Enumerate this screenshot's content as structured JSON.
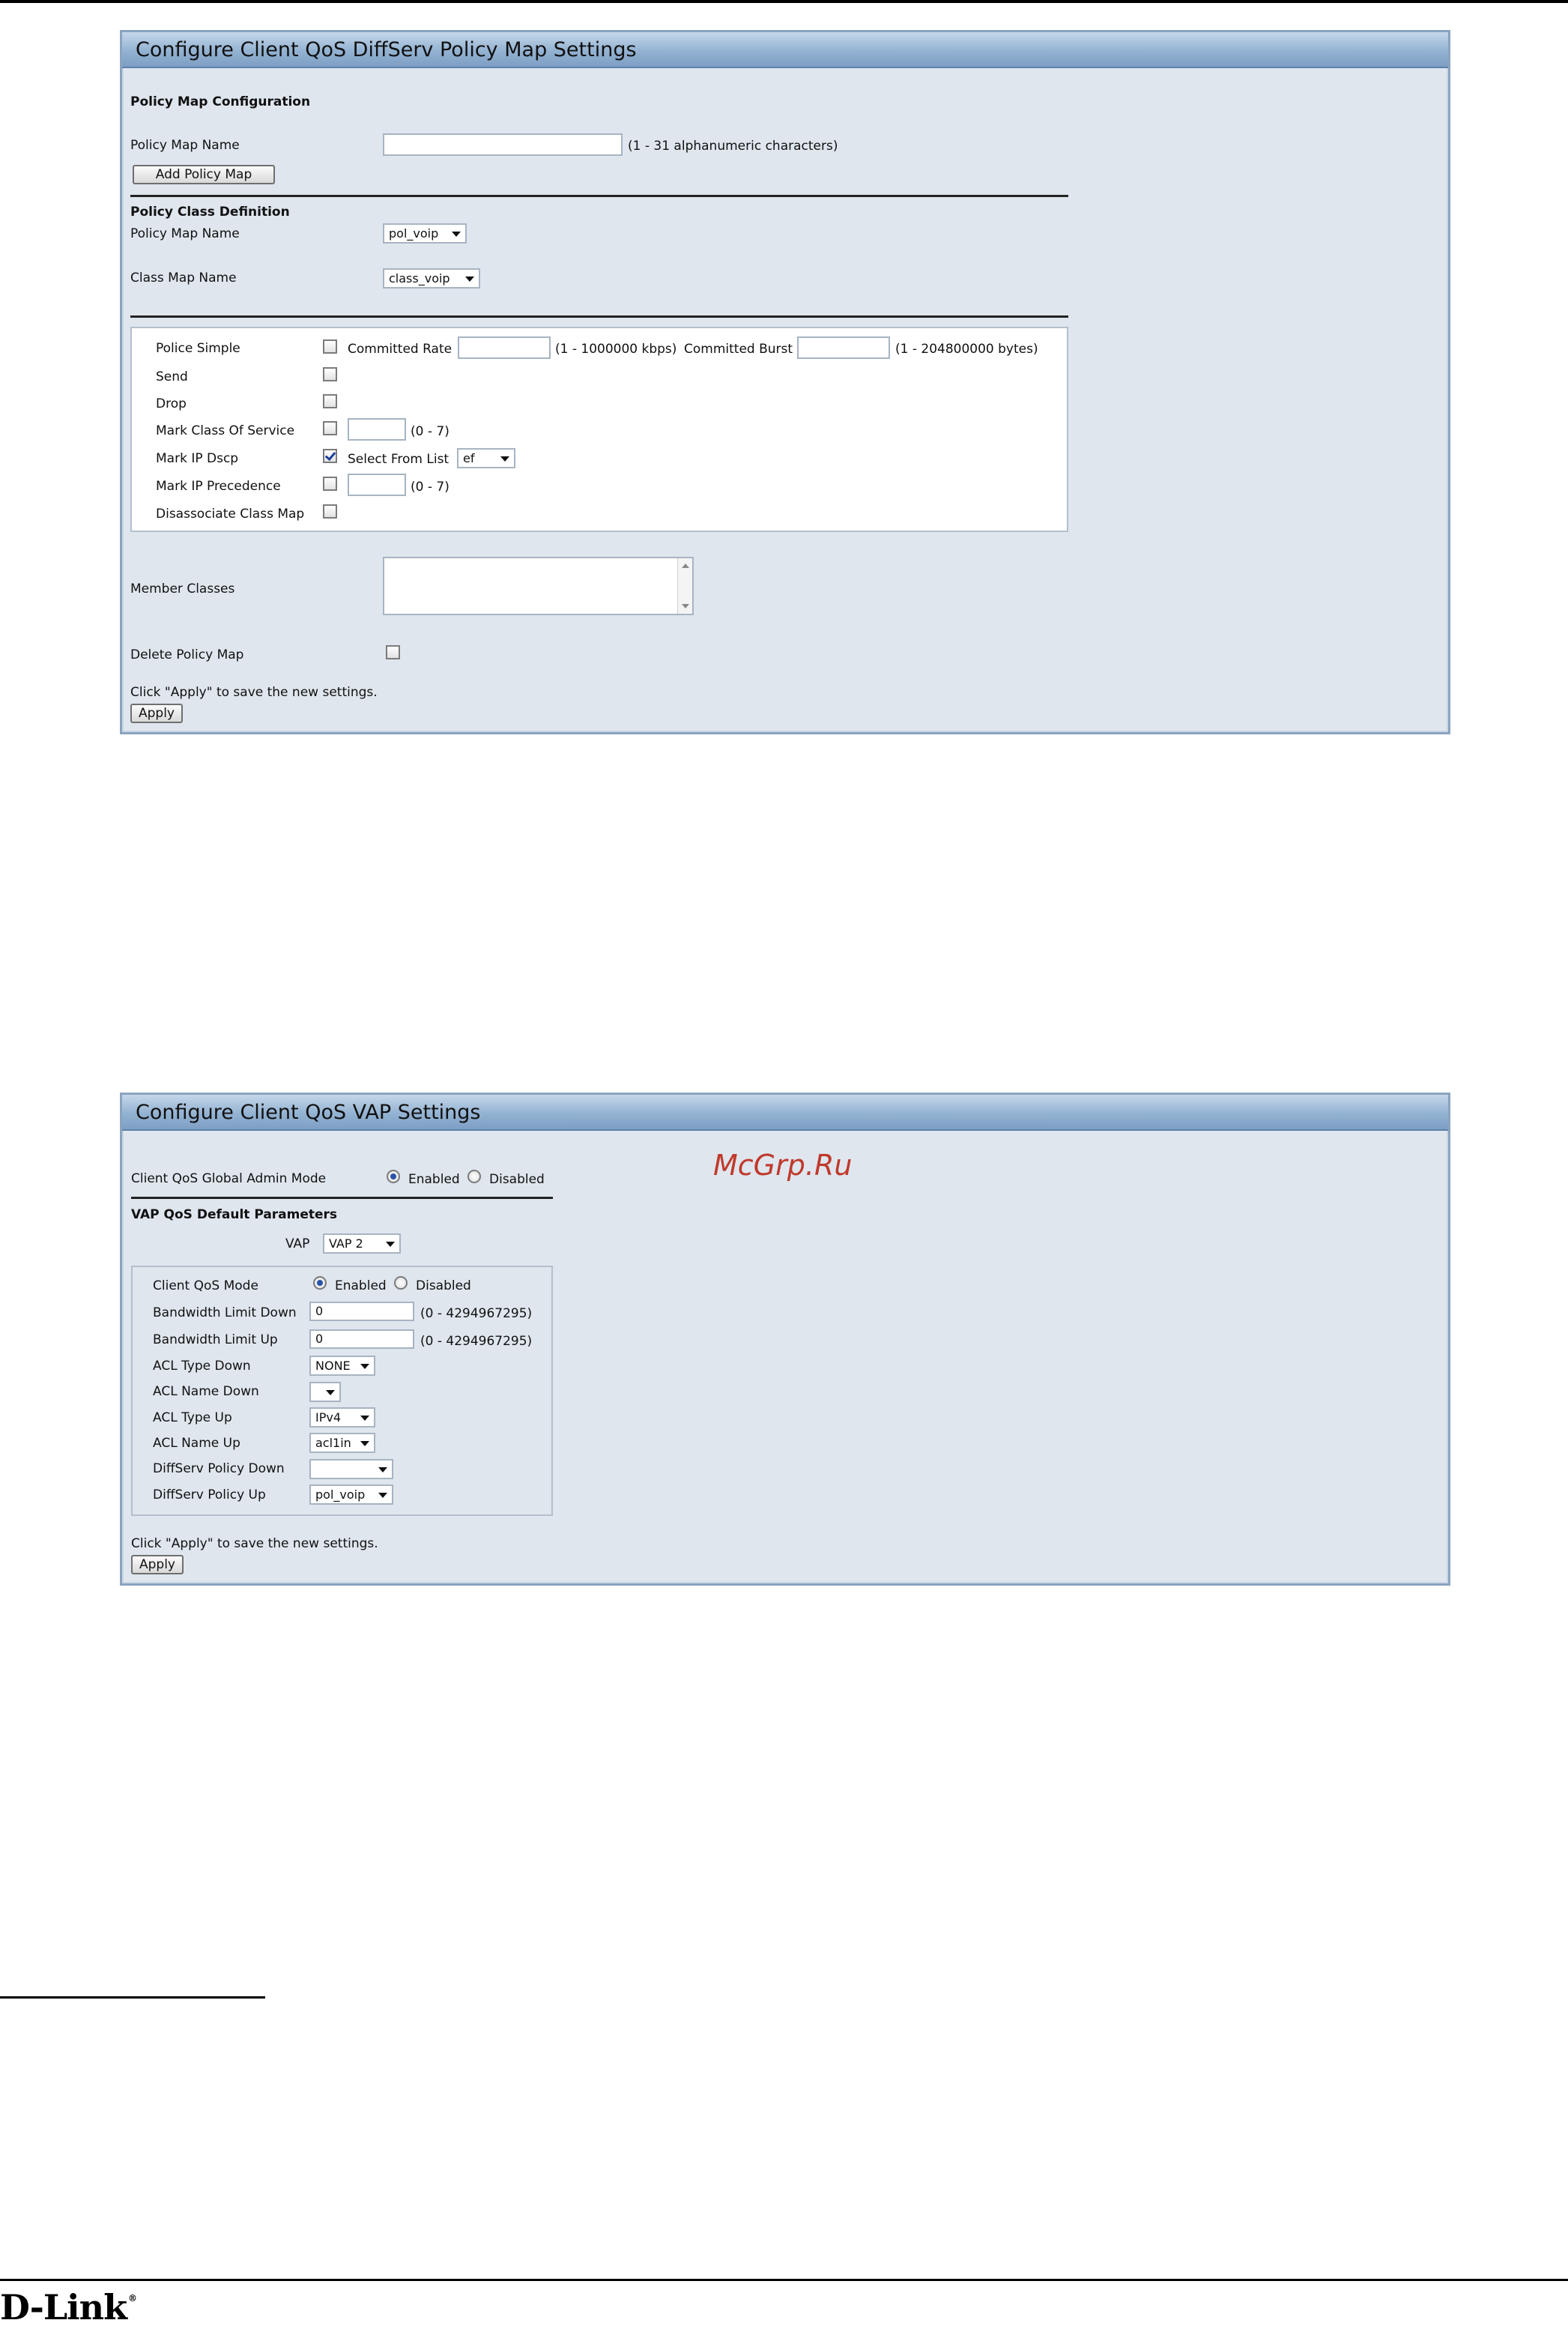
{
  "policy_panel": {
    "title": "Configure Client QoS DiffServ Policy Map Settings",
    "section_policy_map_config": "Policy Map Configuration",
    "policy_map_name_label": "Policy Map Name",
    "policy_map_name_value": "",
    "policy_map_name_hint": "(1 - 31 alphanumeric characters)",
    "add_policy_map_button": "Add Policy Map",
    "section_policy_class_def": "Policy Class Definition",
    "policy_map_select_label": "Policy Map Name",
    "policy_map_select_value": "pol_voip",
    "class_map_label": "Class Map Name",
    "class_map_value": "class_voip",
    "police_simple_label": "Police Simple",
    "police_simple_checked": false,
    "committed_rate_label": "Committed Rate",
    "committed_rate_value": "",
    "committed_rate_hint": "(1 - 1000000 kbps)",
    "committed_burst_label": "Committed Burst",
    "committed_burst_value": "",
    "committed_burst_hint": "(1 - 204800000 bytes)",
    "send_label": "Send",
    "send_checked": false,
    "drop_label": "Drop",
    "drop_checked": false,
    "mark_cos_label": "Mark Class Of Service",
    "mark_cos_checked": false,
    "mark_cos_value": "",
    "mark_cos_hint": "(0 - 7)",
    "mark_dscp_label": "Mark IP Dscp",
    "mark_dscp_checked": true,
    "select_from_list_label": "Select From List",
    "dscp_value": "ef",
    "mark_precedence_label": "Mark IP Precedence",
    "mark_precedence_checked": false,
    "mark_precedence_value": "",
    "mark_precedence_hint": "(0 - 7)",
    "disassociate_label": "Disassociate Class Map",
    "disassociate_checked": false,
    "member_classes_label": "Member Classes",
    "delete_policy_map_label": "Delete Policy Map",
    "delete_policy_map_checked": false,
    "apply_note": "Click \"Apply\" to save the new settings.",
    "apply_button": "Apply"
  },
  "vap_panel": {
    "title": "Configure Client QoS VAP Settings",
    "global_admin_mode_label": "Client QoS Global Admin Mode",
    "global_enabled_label": "Enabled",
    "global_disabled_label": "Disabled",
    "global_mode_selected": "Enabled",
    "section_vap_defaults": "VAP QoS Default Parameters",
    "vap_label": "VAP",
    "vap_value": "VAP 2",
    "client_qos_mode_label": "Client QoS Mode",
    "client_qos_enabled_label": "Enabled",
    "client_qos_disabled_label": "Disabled",
    "client_qos_mode_selected": "Enabled",
    "bw_down_label": "Bandwidth Limit Down",
    "bw_down_value": "0",
    "bw_down_hint": "(0 - 4294967295)",
    "bw_up_label": "Bandwidth Limit Up",
    "bw_up_value": "0",
    "bw_up_hint": "(0 - 4294967295)",
    "acl_type_down_label": "ACL Type Down",
    "acl_type_down_value": "NONE",
    "acl_name_down_label": "ACL Name Down",
    "acl_name_down_value": "",
    "acl_type_up_label": "ACL Type Up",
    "acl_type_up_value": "IPv4",
    "acl_name_up_label": "ACL Name Up",
    "acl_name_up_value": "acl1in",
    "diffserv_down_label": "DiffServ Policy Down",
    "diffserv_down_value": "",
    "diffserv_up_label": "DiffServ Policy Up",
    "diffserv_up_value": "pol_voip",
    "apply_note": "Click \"Apply\" to save the new settings.",
    "apply_button": "Apply"
  },
  "watermark": "McGrp.Ru",
  "footer": {
    "logo_text": "D-Link",
    "logo_mark": "®"
  }
}
